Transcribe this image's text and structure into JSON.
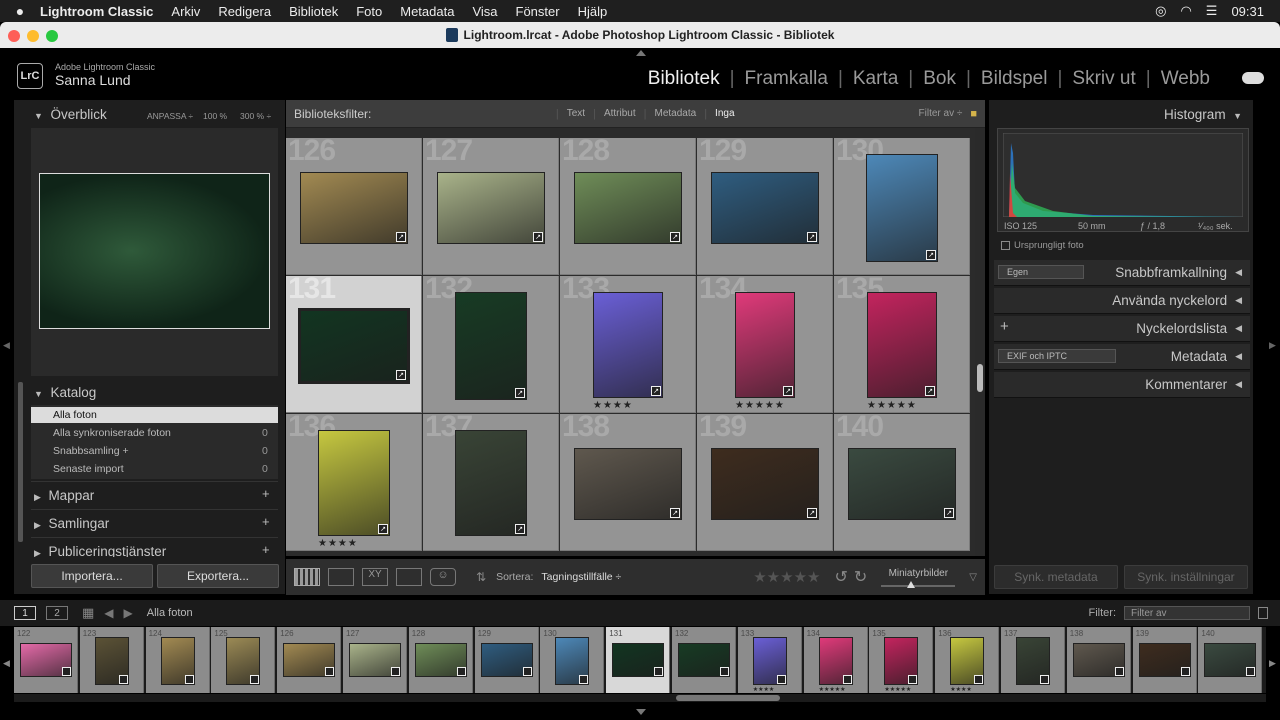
{
  "menubar": {
    "items": [
      "Lightroom Classic",
      "Arkiv",
      "Redigera",
      "Bibliotek",
      "Foto",
      "Metadata",
      "Visa",
      "Fönster",
      "Hjälp"
    ],
    "clock": "09:31"
  },
  "window": {
    "title": "Lightroom.lrcat - Adobe Photoshop Lightroom Classic - Bibliotek"
  },
  "identity": {
    "logo": "LrC",
    "app": "Adobe Lightroom Classic",
    "user": "Sanna Lund"
  },
  "modules": [
    "Bibliotek",
    "Framkalla",
    "Karta",
    "Bok",
    "Bildspel",
    "Skriv ut",
    "Webb"
  ],
  "navigator": {
    "title": "Överblick",
    "zoom": [
      "ANPASSA ÷",
      "100 %",
      "300 % ÷"
    ]
  },
  "catalog": {
    "title": "Katalog",
    "items": [
      {
        "label": "Alla foton",
        "count": ""
      },
      {
        "label": "Alla synkroniserade foton",
        "count": "0"
      },
      {
        "label": "Snabbsamling +",
        "count": "0"
      },
      {
        "label": "Senaste import",
        "count": "0"
      }
    ]
  },
  "folders": {
    "title": "Mappar"
  },
  "collections": {
    "title": "Samlingar"
  },
  "publish": {
    "title": "Publiceringstjänster"
  },
  "buttons": {
    "import": "Importera...",
    "export": "Exportera...",
    "sync_meta": "Synk. metadata",
    "sync_settings": "Synk. inställningar"
  },
  "filterbar": {
    "label": "Biblioteksfilter:",
    "tabs": [
      "Text",
      "Attribut",
      "Metadata",
      "Inga"
    ],
    "preset": "Filter av ÷"
  },
  "grid": {
    "cells": [
      {
        "num": "126",
        "stars": ""
      },
      {
        "num": "127",
        "stars": ""
      },
      {
        "num": "128",
        "stars": ""
      },
      {
        "num": "129",
        "stars": ""
      },
      {
        "num": "130",
        "stars": ""
      },
      {
        "num": "131",
        "stars": ""
      },
      {
        "num": "132",
        "stars": ""
      },
      {
        "num": "133",
        "stars": "★★★★"
      },
      {
        "num": "134",
        "stars": "★★★★★"
      },
      {
        "num": "135",
        "stars": "★★★★★"
      },
      {
        "num": "136",
        "stars": "★★★★"
      },
      {
        "num": "137",
        "stars": ""
      },
      {
        "num": "138",
        "stars": ""
      },
      {
        "num": "139",
        "stars": ""
      },
      {
        "num": "140",
        "stars": ""
      }
    ],
    "colors": [
      "#a28a52",
      "#a9b38a",
      "#6f8d58",
      "#2f5d80",
      "#4d88b8",
      "#123521",
      "#173b24",
      "#6a5fd6",
      "#e03a7a",
      "#c3245e",
      "#c6c840",
      "#394436",
      "#5f584e",
      "#3e2c1e",
      "#3a4a40"
    ]
  },
  "toolbar": {
    "sort_label": "Sortera:",
    "sort_value": "Tagningstillfälle ÷",
    "thumbs_label": "Miniatyrbilder"
  },
  "histogram": {
    "title": "Histogram",
    "iso": "ISO 125",
    "focal": "50 mm",
    "aperture": "ƒ / 1,8",
    "shutter": "¹⁄₄₀₀ sek.",
    "original": "Ursprungligt foto"
  },
  "rightpanel": {
    "quick_preset": "Egen",
    "quick": "Snabbframkallning",
    "keywording": "Använda nyckelord",
    "keywordlist": "Nyckelordslista",
    "metadata_preset": "EXIF och IPTC",
    "metadata": "Metadata",
    "comments": "Kommentarer"
  },
  "filmhdr": {
    "page1": "1",
    "page2": "2",
    "source": "Alla foton",
    "filter_label": "Filter:",
    "filter_value": "Filter av"
  },
  "filmstrip": {
    "cells": [
      {
        "num": "122",
        "stars": ""
      },
      {
        "num": "123",
        "stars": ""
      },
      {
        "num": "124",
        "stars": ""
      },
      {
        "num": "125",
        "stars": ""
      },
      {
        "num": "126",
        "stars": ""
      },
      {
        "num": "127",
        "stars": ""
      },
      {
        "num": "128",
        "stars": ""
      },
      {
        "num": "129",
        "stars": ""
      },
      {
        "num": "130",
        "stars": ""
      },
      {
        "num": "131",
        "stars": ""
      },
      {
        "num": "132",
        "stars": ""
      },
      {
        "num": "133",
        "stars": "★★★★"
      },
      {
        "num": "134",
        "stars": "★★★★★"
      },
      {
        "num": "135",
        "stars": "★★★★★"
      },
      {
        "num": "136",
        "stars": "★★★★"
      },
      {
        "num": "137",
        "stars": ""
      },
      {
        "num": "138",
        "stars": ""
      },
      {
        "num": "139",
        "stars": ""
      },
      {
        "num": "140",
        "stars": ""
      }
    ],
    "colors": [
      "#e46aa8",
      "#5b5236",
      "#a28a52",
      "#9b8a55",
      "#a28a52",
      "#a9b38a",
      "#6f8d58",
      "#2f5d80",
      "#4d88b8",
      "#123521",
      "#173b24",
      "#6a5fd6",
      "#e03a7a",
      "#c3245e",
      "#c6c840",
      "#394436",
      "#5f584e",
      "#3e2c1e",
      "#3a4a40"
    ]
  }
}
